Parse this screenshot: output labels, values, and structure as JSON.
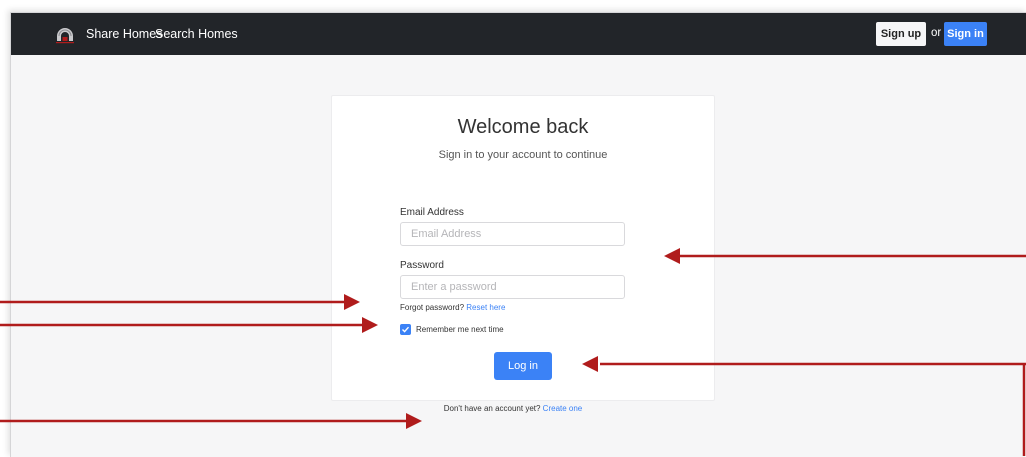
{
  "navbar": {
    "logo_icon": "house-arch-logo-icon",
    "links": [
      "Share Homes",
      "Search Homes"
    ],
    "signup_label": "Sign up",
    "or_text": "or",
    "signin_label": "Sign in"
  },
  "card": {
    "title": "Welcome back",
    "subtitle": "Sign in to your account to continue",
    "email_label": "Email Address",
    "email_placeholder": "Email Address",
    "password_label": "Password",
    "password_placeholder": "Enter a password",
    "forgot_text": "Forgot password?",
    "reset_link": "Reset here",
    "remember_label": "Remember me next time",
    "remember_checked": true,
    "login_label": "Log in"
  },
  "footer": {
    "create_text": "Don't have an account yet?",
    "create_link": "Create one"
  },
  "colors": {
    "navbar_bg": "#222529",
    "accent": "#3b82f6",
    "annotation_arrow": "#b01c1c"
  }
}
